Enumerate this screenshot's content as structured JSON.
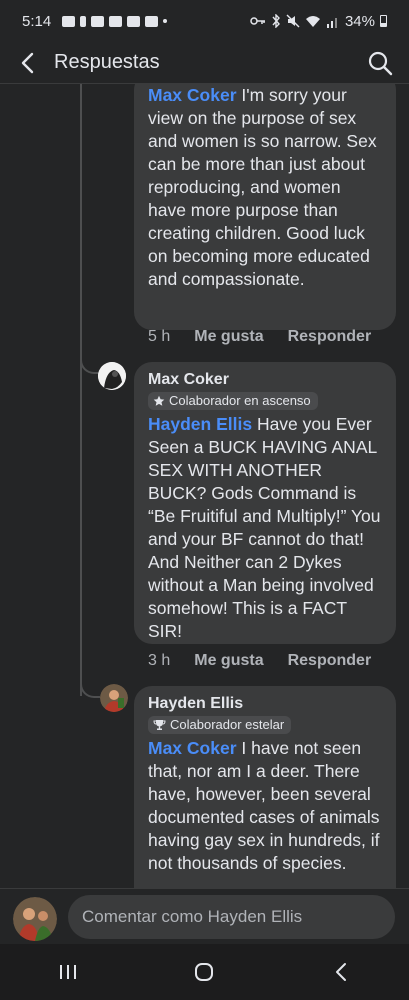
{
  "status_bar": {
    "time": "5:14",
    "battery": "34%"
  },
  "header": {
    "title": "Respuestas"
  },
  "comments": [
    {
      "mention": "Max Coker",
      "text": " I'm sorry your view on the purpose of sex and women is so narrow. Sex can be more than just about reproducing, and women have more purpose than creating children. Good luck on becoming more educated and compassionate.",
      "time": "5 h",
      "like": "Me gusta",
      "reply": "Responder"
    },
    {
      "author": "Max Coker",
      "badge": "Colaborador en ascenso",
      "badge_icon": "star-icon",
      "mention": "Hayden Ellis",
      "text": " Have you Ever Seen a BUCK HAVING ANAL SEX WITH ANOTHER BUCK? Gods Command is “Be Fruitiful and Multiply!” You and your BF cannot do that! And Neither can 2 Dykes without a Man being involved somehow! This is a FACT SIR!",
      "time": "3 h",
      "like": "Me gusta",
      "reply": "Responder"
    },
    {
      "author": "Hayden Ellis",
      "badge": "Colaborador estelar",
      "badge_icon": "trophy-icon",
      "mention": "Max Coker",
      "text": " I have not seen that,  nor am I a deer. There have,  however,  been several documented cases of animals having gay sex in hundreds, if not thousands of species."
    }
  ],
  "composer": {
    "placeholder": "Comentar como Hayden Ellis"
  },
  "colors": {
    "background": "#242526",
    "bubble": "#3a3b3c",
    "mention": "#4a8df8",
    "muted": "#b0b3b8"
  }
}
